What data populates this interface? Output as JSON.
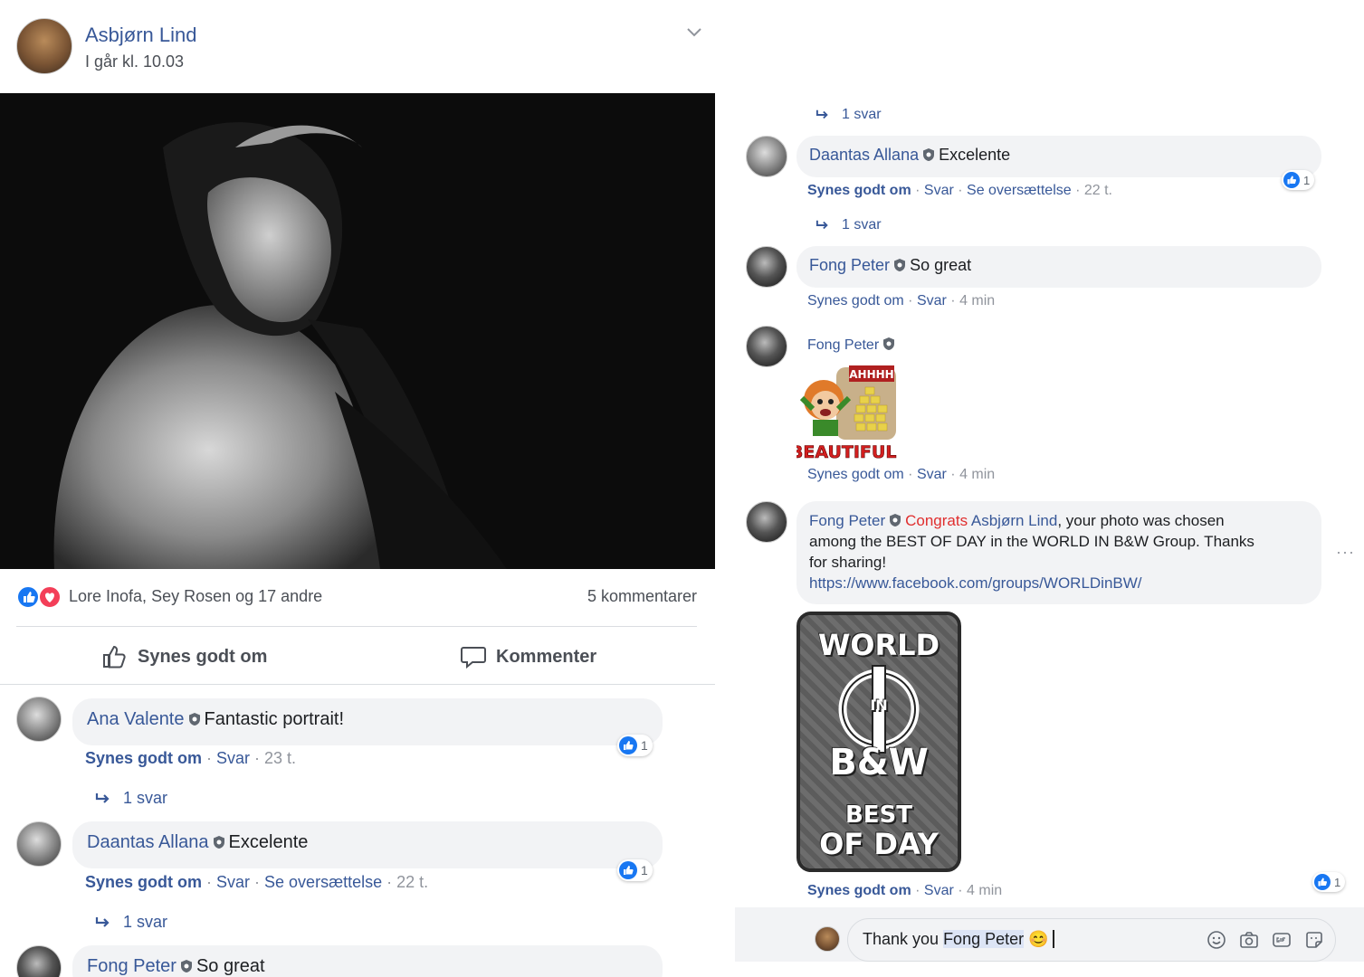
{
  "post": {
    "author": "Asbjørn Lind",
    "time": "I går kl. 10.03",
    "reactions_text": "Lore Inofa, Sey Rosen og 17 andre",
    "comment_count": "5 kommentarer",
    "like_action": "Synes godt om",
    "comment_action": "Kommenter"
  },
  "left_comments": [
    {
      "author": "Ana Valente",
      "text": "Fantastic portrait!",
      "like": "Synes godt om",
      "reply": "Svar",
      "time": "23 t.",
      "likes": "1",
      "replies": "1 svar"
    },
    {
      "author": "Daantas Allana",
      "text": "Excelente",
      "like": "Synes godt om",
      "reply": "Svar",
      "translate": "Se oversættelse",
      "time": "22 t.",
      "likes": "1",
      "replies": "1 svar"
    },
    {
      "author": "Fong Peter",
      "text": "So great"
    }
  ],
  "right": {
    "top_replies": "1 svar",
    "c1": {
      "author": "Daantas Allana",
      "text": "Excelente",
      "like": "Synes godt om",
      "reply": "Svar",
      "translate": "Se oversættelse",
      "time": "22 t.",
      "likes": "1",
      "replies": "1 svar"
    },
    "c2": {
      "author": "Fong Peter",
      "text": "So great",
      "like": "Synes godt om",
      "reply": "Svar",
      "time": "4 min"
    },
    "c3": {
      "author": "Fong Peter",
      "sticker_top": "AHHHH",
      "sticker_bottom": "BEAUTIFUL!",
      "like": "Synes godt om",
      "reply": "Svar",
      "time": "4 min"
    },
    "c4": {
      "author": "Fong Peter",
      "congrats": "Congrats",
      "mention": "Asbjørn Lind",
      "line1_rest": ", your photo was chosen",
      "line2": "among the BEST OF DAY in the WORLD IN B&W Group. Thanks",
      "line3": "for sharing!",
      "link": "https://www.facebook.com/groups/WORLDinBW/",
      "badge_world": "WORLD",
      "badge_in": "IN",
      "badge_bw": "B&W",
      "badge_best": "BEST",
      "badge_ofday": "OF DAY",
      "like": "Synes godt om",
      "reply": "Svar",
      "time": "4 min",
      "likes": "1"
    },
    "more": "···",
    "composer": {
      "prefix": "Thank you ",
      "mention": "Fong Peter",
      "emoji": "😊"
    }
  },
  "colors": {
    "link": "#385898",
    "like_blue": "#1877f2",
    "heart_red": "#f33e58",
    "bubble": "#f2f3f5",
    "congrats_red": "#e02e2e"
  }
}
